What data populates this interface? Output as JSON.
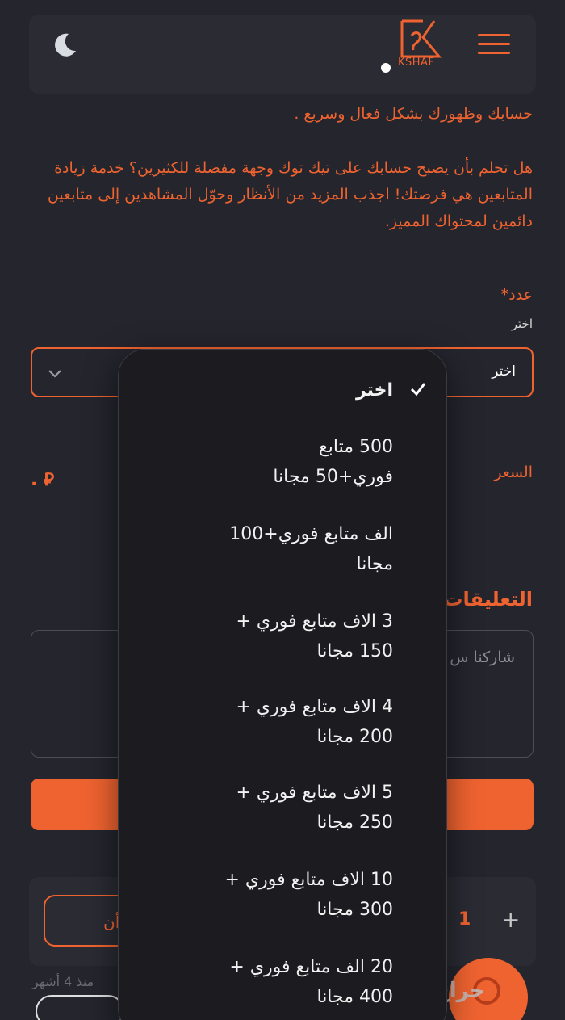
{
  "header": {
    "logo_text": "KSHAF",
    "icons": [
      "moon-icon",
      "menu-icon"
    ]
  },
  "description": {
    "line_top": "حسابك وظهورك بشكل فعال وسريع .",
    "paragraph": "هل تحلم بأن يصبح حسابك على تيك توك وجهة مفضلة للكثيرين؟ خدمة زيادة المتابعين هي فرصتك! اجذب المزيد من الأنظار وحوّل المشاهدين إلى متابعين دائمين لمحتواك المميز."
  },
  "form": {
    "count_label": "عدد",
    "required_mark": "*",
    "choose_hint": "اختر",
    "select_value": "اختر",
    "price_label": "السعر",
    "price_value": ". ⃁",
    "comments_label": "التعليقات",
    "comment_placeholder": "شاركنا س"
  },
  "quantity": {
    "value": "1",
    "plus": "+",
    "button_label": "أن"
  },
  "footer": {
    "partial_text": "منذ 4 أشهر",
    "watermark": "حراج"
  },
  "dropdown": {
    "selected_index": 0,
    "options": [
      {
        "line1": "اختر",
        "line2": ""
      },
      {
        "line1": "500 متابع",
        "line2": "فوري+50 مجانا"
      },
      {
        "line1": "الف متابع فوري+100",
        "line2": "مجانا"
      },
      {
        "line1": "3 الاف متابع فوري +",
        "line2": "150 مجانا"
      },
      {
        "line1": "4 الاف متابع فوري +",
        "line2": "200 مجانا"
      },
      {
        "line1": "5 الاف متابع فوري +",
        "line2": "250 مجانا"
      },
      {
        "line1": "10 الاف متابع فوري +",
        "line2": "300 مجانا"
      },
      {
        "line1": "20 الف متابع فوري +",
        "line2": "400 مجانا"
      }
    ]
  },
  "colors": {
    "accent": "#ef6330",
    "background": "#24252d",
    "popover": "#1b1b20"
  }
}
